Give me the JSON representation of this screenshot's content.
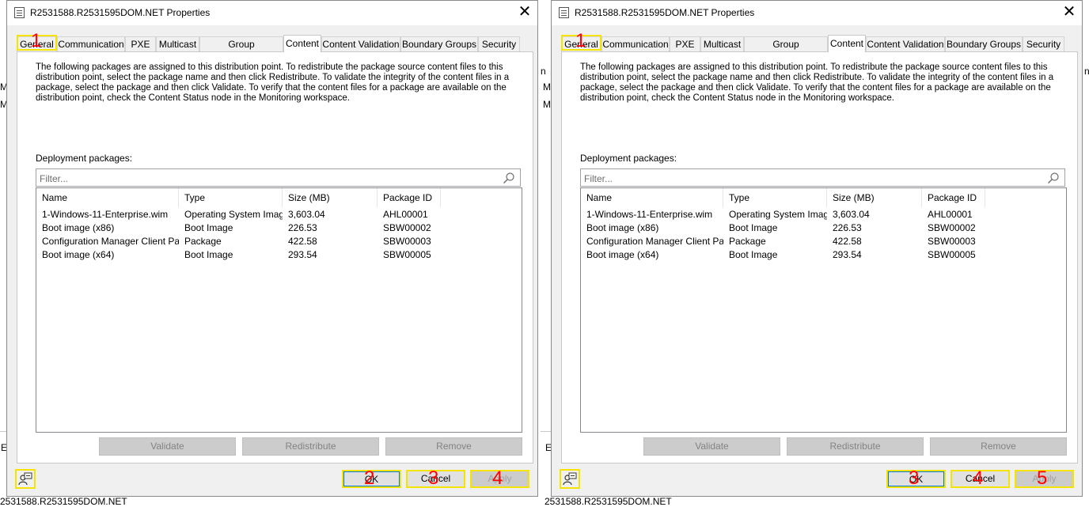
{
  "background": {
    "left_letters": [
      "M",
      "M"
    ],
    "right_letters": [
      "n",
      "n"
    ],
    "mid_letters": [
      "M",
      "M"
    ],
    "bottom_left": "E",
    "bottom_mid": "E",
    "bottom_text": "2531588.R2531595DOM.NET"
  },
  "dialog": {
    "title": "R2531588.R2531595DOM.NET Properties",
    "close_glyph": "✕",
    "tabs": [
      "General",
      "Communication",
      "PXE",
      "Multicast",
      "Group Relationships",
      "Content",
      "Content Validation",
      "Boundary Groups",
      "Security"
    ],
    "active_tab": "Content",
    "description": "The following packages are assigned to this distribution point. To redistribute the package source content files to this distribution point, select the package name and then click Redistribute. To validate the integrity of the content files in a package, select the package and then click Validate. To verify that the content files for a package are available on the distribution point, check the Content Status node in the Monitoring workspace.",
    "deployment_label": "Deployment packages:",
    "filter_placeholder": "Filter...",
    "columns": [
      "Name",
      "Type",
      "Size (MB)",
      "Package ID"
    ],
    "rows": [
      [
        "1-Windows-11-Enterprise.wim",
        "Operating System Image",
        "3,603.04",
        "AHL00001"
      ],
      [
        "Boot image (x86)",
        "Boot Image",
        "226.53",
        "SBW00002"
      ],
      [
        "Configuration Manager Client Pac...",
        "Package",
        "422.58",
        "SBW00003"
      ],
      [
        "Boot image (x64)",
        "Boot Image",
        "293.54",
        "SBW00005"
      ]
    ],
    "buttons": {
      "validate": "Validate",
      "redistribute": "Redistribute",
      "remove": "Remove",
      "ok": "OK",
      "cancel": "Cancel",
      "apply": "Apply"
    }
  },
  "annotations": {
    "left": [
      "1",
      "2",
      "3",
      "4"
    ],
    "right": [
      "1",
      "3",
      "4",
      "5"
    ]
  },
  "colors": {
    "highlight": "#f4e400",
    "annotation_number": "#ff0000",
    "ok_focus": "#0078d7"
  }
}
